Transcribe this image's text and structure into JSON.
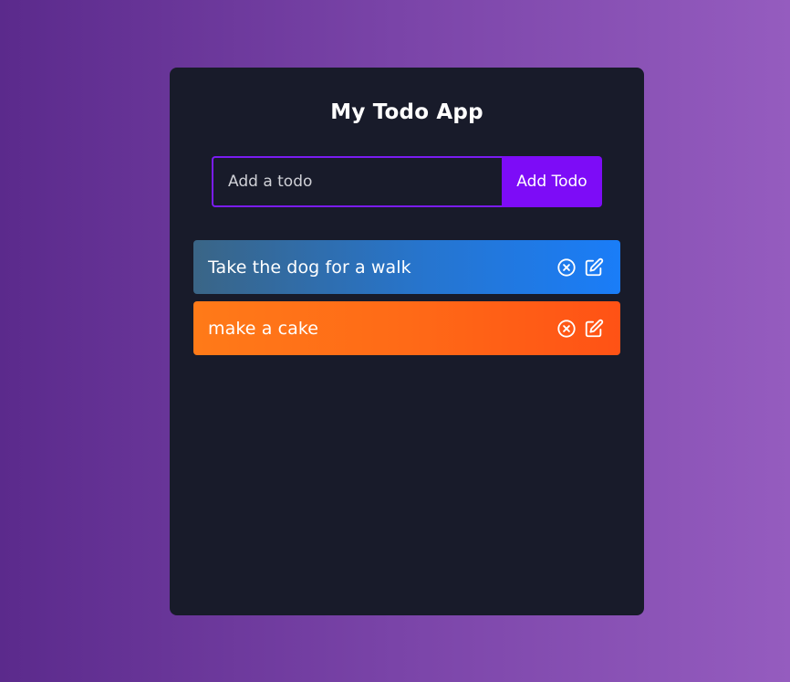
{
  "app": {
    "title": "My Todo App"
  },
  "form": {
    "input_placeholder": "Add a todo",
    "input_value": "",
    "submit_label": "Add Todo"
  },
  "todos": [
    {
      "text": "Take the dog for a walk",
      "color": "blue",
      "icons": [
        "close-circle-icon",
        "edit-icon"
      ]
    },
    {
      "text": "make a cake",
      "color": "orange",
      "icons": [
        "close-circle-icon",
        "edit-icon"
      ]
    }
  ],
  "colors": {
    "background_gradient": [
      "#5b2a8c",
      "#955cbf"
    ],
    "panel": "#181b2a",
    "accent": "#7d0cf7",
    "item_blue": [
      "#3a6586",
      "#1a7df8"
    ],
    "item_orange": [
      "#ff7a18",
      "#ff5215"
    ]
  }
}
